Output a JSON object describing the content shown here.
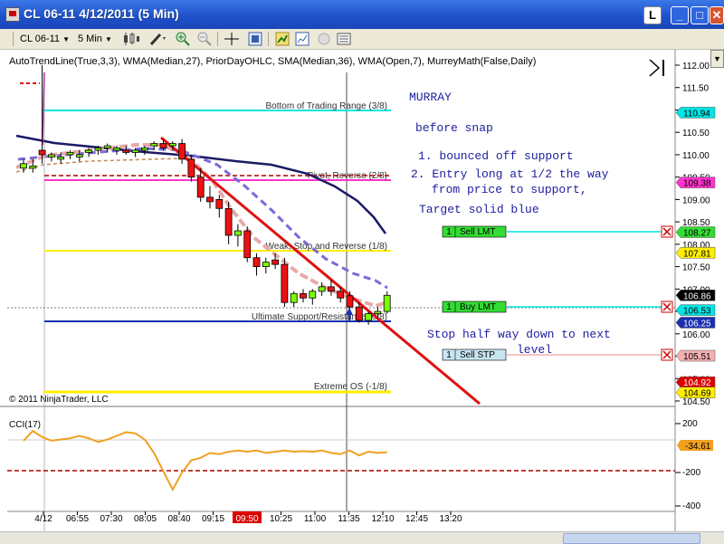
{
  "window": {
    "title": "CL 06-11  4/12/2011 (5 Min)",
    "l_button": "L",
    "colors": {
      "titlebar": "#1d4fc9",
      "close": "#d8532f"
    }
  },
  "toolbar": {
    "instrument": "CL 06-11",
    "interval": "5 Min",
    "icons": [
      "candlestick-icon",
      "pencil-icon",
      "zoom-in-icon",
      "zoom-out-icon",
      "crosshair-icon",
      "properties-icon",
      "strategy-icon",
      "chart-trader-icon",
      "data-box-icon",
      "list-icon"
    ]
  },
  "chart": {
    "indicator_line": "AutoTrendLine(True,3,3), WMA(Median,27), PriorDayOHLC, SMA(Median,36), WMA(Open,7), MurreyMath(False,Daily)",
    "copyright": "© 2011 NinjaTrader, LLC",
    "murrey_levels": [
      {
        "label": "Bottom of Trading Range (3/8)",
        "price": 110.94,
        "color": "#00e5e5"
      },
      {
        "label": "Pivot, Reverse (2/8)",
        "price": 109.38,
        "color": "#ff33cc"
      },
      {
        "label": "Weak, Stop and Reverse (1/8)",
        "price": 107.81,
        "color": "#ffee00"
      },
      {
        "label": "Ultimate Support/Resistance (0/8)",
        "price": 106.25,
        "color": "#1a2fb0"
      },
      {
        "label": "Extreme OS (-1/8)",
        "price": 104.69,
        "color": "#ffee00"
      }
    ],
    "annotation": {
      "title": "MURRAY",
      "line1": "before snap",
      "line2": "1. bounced off support",
      "line3": "2. Entry long at 1/2 the way",
      "line4": "from price to support,",
      "line5": "Target solid blue",
      "line6": "Stop half way down to next",
      "line7": "level"
    },
    "orders": [
      {
        "qty": "1",
        "label": "Sell LMT",
        "price": 108.27,
        "color": "#33dd33"
      },
      {
        "qty": "1",
        "label": "Buy LMT",
        "price": 106.53,
        "color": "#33dd33"
      },
      {
        "qty": "1",
        "label": "Sell STP",
        "price": 105.51,
        "color": "#c8e4f0"
      }
    ],
    "price_axis": {
      "ticks": [
        "112.00",
        "111.50",
        "111.00",
        "110.50",
        "110.00",
        "109.50",
        "109.00",
        "108.50",
        "108.00",
        "107.50",
        "107.00",
        "106.50",
        "106.00",
        "105.50",
        "105.00",
        "104.50"
      ],
      "markers": [
        {
          "value": "110.94",
          "color": "#00e5e5",
          "text_color": "#000"
        },
        {
          "value": "109.38",
          "color": "#ff33cc",
          "text_color": "#000"
        },
        {
          "value": "108.27",
          "color": "#33dd33",
          "text_color": "#000"
        },
        {
          "value": "107.81",
          "color": "#ffee00",
          "text_color": "#000"
        },
        {
          "value": "106.86",
          "color": "#000000",
          "text_color": "#fff"
        },
        {
          "value": "106.53",
          "color": "#00e5e5",
          "text_color": "#000"
        },
        {
          "value": "106.25",
          "color": "#1a2fb0",
          "text_color": "#fff"
        },
        {
          "value": "105.51",
          "color": "#f4b0b0",
          "text_color": "#000"
        },
        {
          "value": "104.92",
          "color": "#dd0000",
          "text_color": "#fff"
        },
        {
          "value": "104.69",
          "color": "#ffee00",
          "text_color": "#000"
        }
      ]
    },
    "cci": {
      "label": "CCI(17)",
      "ticks": [
        "200",
        "-200",
        "-400"
      ],
      "current": "-34.61",
      "color": "#f0a020"
    },
    "time_axis": {
      "ticks": [
        "4/12",
        "06:55",
        "07:30",
        "08:05",
        "08:40",
        "09:15",
        "09:50",
        "10:25",
        "11:00",
        "11:35",
        "12:10",
        "12:45",
        "13:20"
      ],
      "highlight": "09:50"
    }
  },
  "chart_data": {
    "type": "candlestick",
    "title": "CL 06-11  4/12/2011 (5 Min)",
    "candles": [
      {
        "o": 109.7,
        "h": 109.9,
        "l": 109.6,
        "c": 109.8,
        "dir": "up"
      },
      {
        "o": 109.75,
        "h": 109.9,
        "l": 109.6,
        "c": 109.7,
        "dir": "up"
      },
      {
        "o": 110.1,
        "h": 112.0,
        "l": 109.8,
        "c": 110.0,
        "dir": "down"
      },
      {
        "o": 109.95,
        "h": 110.05,
        "l": 109.85,
        "c": 110.0,
        "dir": "up"
      },
      {
        "o": 109.9,
        "h": 110.05,
        "l": 109.8,
        "c": 109.95,
        "dir": "up"
      },
      {
        "o": 110.0,
        "h": 110.1,
        "l": 109.9,
        "c": 110.05,
        "dir": "up"
      },
      {
        "o": 109.95,
        "h": 110.1,
        "l": 109.85,
        "c": 110.0,
        "dir": "up"
      },
      {
        "o": 110.05,
        "h": 110.15,
        "l": 109.95,
        "c": 110.1,
        "dir": "up"
      },
      {
        "o": 110.1,
        "h": 110.2,
        "l": 110.0,
        "c": 110.15,
        "dir": "up"
      },
      {
        "o": 110.15,
        "h": 110.25,
        "l": 110.05,
        "c": 110.2,
        "dir": "up"
      },
      {
        "o": 110.1,
        "h": 110.2,
        "l": 110.0,
        "c": 110.15,
        "dir": "up"
      },
      {
        "o": 110.1,
        "h": 110.2,
        "l": 110.0,
        "c": 110.05,
        "dir": "down"
      },
      {
        "o": 110.05,
        "h": 110.15,
        "l": 109.95,
        "c": 110.1,
        "dir": "up"
      },
      {
        "o": 110.1,
        "h": 110.2,
        "l": 110.0,
        "c": 110.15,
        "dir": "up"
      },
      {
        "o": 110.2,
        "h": 110.3,
        "l": 110.1,
        "c": 110.25,
        "dir": "up"
      },
      {
        "o": 110.25,
        "h": 110.35,
        "l": 110.1,
        "c": 110.15,
        "dir": "down"
      },
      {
        "o": 110.2,
        "h": 110.3,
        "l": 110.1,
        "c": 110.25,
        "dir": "up"
      },
      {
        "o": 110.25,
        "h": 110.35,
        "l": 109.8,
        "c": 109.9,
        "dir": "down"
      },
      {
        "o": 109.9,
        "h": 110.0,
        "l": 109.4,
        "c": 109.5,
        "dir": "down"
      },
      {
        "o": 109.5,
        "h": 109.7,
        "l": 108.95,
        "c": 109.05,
        "dir": "down"
      },
      {
        "o": 109.05,
        "h": 109.3,
        "l": 108.8,
        "c": 108.95,
        "dir": "down"
      },
      {
        "o": 109.0,
        "h": 109.1,
        "l": 108.6,
        "c": 108.8,
        "dir": "down"
      },
      {
        "o": 108.8,
        "h": 108.95,
        "l": 108.0,
        "c": 108.2,
        "dir": "down"
      },
      {
        "o": 108.2,
        "h": 108.45,
        "l": 107.95,
        "c": 108.3,
        "dir": "up"
      },
      {
        "o": 108.3,
        "h": 108.4,
        "l": 107.6,
        "c": 107.7,
        "dir": "down"
      },
      {
        "o": 107.7,
        "h": 107.8,
        "l": 107.3,
        "c": 107.5,
        "dir": "down"
      },
      {
        "o": 107.5,
        "h": 107.7,
        "l": 107.35,
        "c": 107.6,
        "dir": "up"
      },
      {
        "o": 107.65,
        "h": 107.8,
        "l": 107.45,
        "c": 107.55,
        "dir": "down"
      },
      {
        "o": 107.55,
        "h": 107.7,
        "l": 106.6,
        "c": 106.7,
        "dir": "down"
      },
      {
        "o": 106.7,
        "h": 106.95,
        "l": 106.6,
        "c": 106.9,
        "dir": "up"
      },
      {
        "o": 106.9,
        "h": 107.0,
        "l": 106.7,
        "c": 106.8,
        "dir": "down"
      },
      {
        "o": 106.8,
        "h": 107.0,
        "l": 106.65,
        "c": 106.95,
        "dir": "up"
      },
      {
        "o": 106.95,
        "h": 107.15,
        "l": 106.85,
        "c": 107.05,
        "dir": "up"
      },
      {
        "o": 107.05,
        "h": 107.2,
        "l": 106.85,
        "c": 106.95,
        "dir": "down"
      },
      {
        "o": 106.95,
        "h": 107.05,
        "l": 106.7,
        "c": 106.8,
        "dir": "down"
      },
      {
        "o": 106.85,
        "h": 106.95,
        "l": 106.55,
        "c": 106.6,
        "dir": "down"
      },
      {
        "o": 106.6,
        "h": 106.7,
        "l": 106.25,
        "c": 106.3,
        "dir": "down"
      },
      {
        "o": 106.3,
        "h": 106.5,
        "l": 106.2,
        "c": 106.45,
        "dir": "up"
      },
      {
        "o": 106.45,
        "h": 106.6,
        "l": 106.35,
        "c": 106.5,
        "dir": "up"
      },
      {
        "o": 106.5,
        "h": 106.95,
        "l": 106.45,
        "c": 106.86,
        "dir": "up"
      }
    ],
    "cci": [
      60,
      140,
      90,
      60,
      70,
      80,
      100,
      80,
      50,
      70,
      100,
      130,
      120,
      70,
      -40,
      -190,
      -340,
      -200,
      -100,
      -80,
      -40,
      -50,
      -30,
      -20,
      -30,
      -20,
      -40,
      -30,
      -20,
      -30,
      -25,
      -30,
      -20,
      -40,
      -50,
      -20,
      -60,
      -30,
      -40,
      -34.61
    ],
    "ylim": [
      104.4,
      112.15
    ]
  }
}
